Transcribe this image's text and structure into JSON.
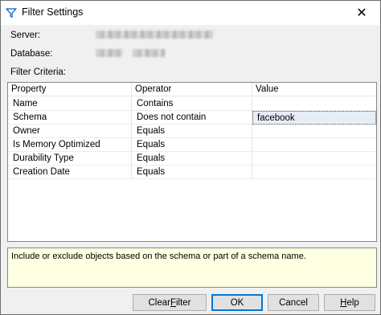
{
  "window": {
    "title": "Filter Settings",
    "close_glyph": "✕"
  },
  "labels": {
    "server": "Server:",
    "database": "Database:",
    "filter_criteria": "Filter Criteria:"
  },
  "grid": {
    "headers": [
      "Property",
      "Operator",
      "Value"
    ],
    "rows": [
      {
        "property": "Name",
        "operator": "Contains",
        "value": ""
      },
      {
        "property": "Schema",
        "operator": "Does not contain",
        "value": "facebook"
      },
      {
        "property": "Owner",
        "operator": "Equals",
        "value": ""
      },
      {
        "property": "Is Memory Optimized",
        "operator": "Equals",
        "value": ""
      },
      {
        "property": "Durability Type",
        "operator": "Equals",
        "value": ""
      },
      {
        "property": "Creation Date",
        "operator": "Equals",
        "value": ""
      }
    ]
  },
  "description": "Include or exclude objects based on the schema or part of a schema name.",
  "buttons": {
    "clear_filter_pre": "Clear ",
    "clear_filter_u": "F",
    "clear_filter_post": "ilter",
    "ok": "OK",
    "cancel": "Cancel",
    "help_u": "H",
    "help_post": "elp"
  },
  "colors": {
    "accent": "#0078d7",
    "description_bg": "#ffffe1",
    "filter_icon": "#1e73d2"
  },
  "icons": {
    "title": "filter-funnel-icon",
    "close": "close-icon"
  }
}
